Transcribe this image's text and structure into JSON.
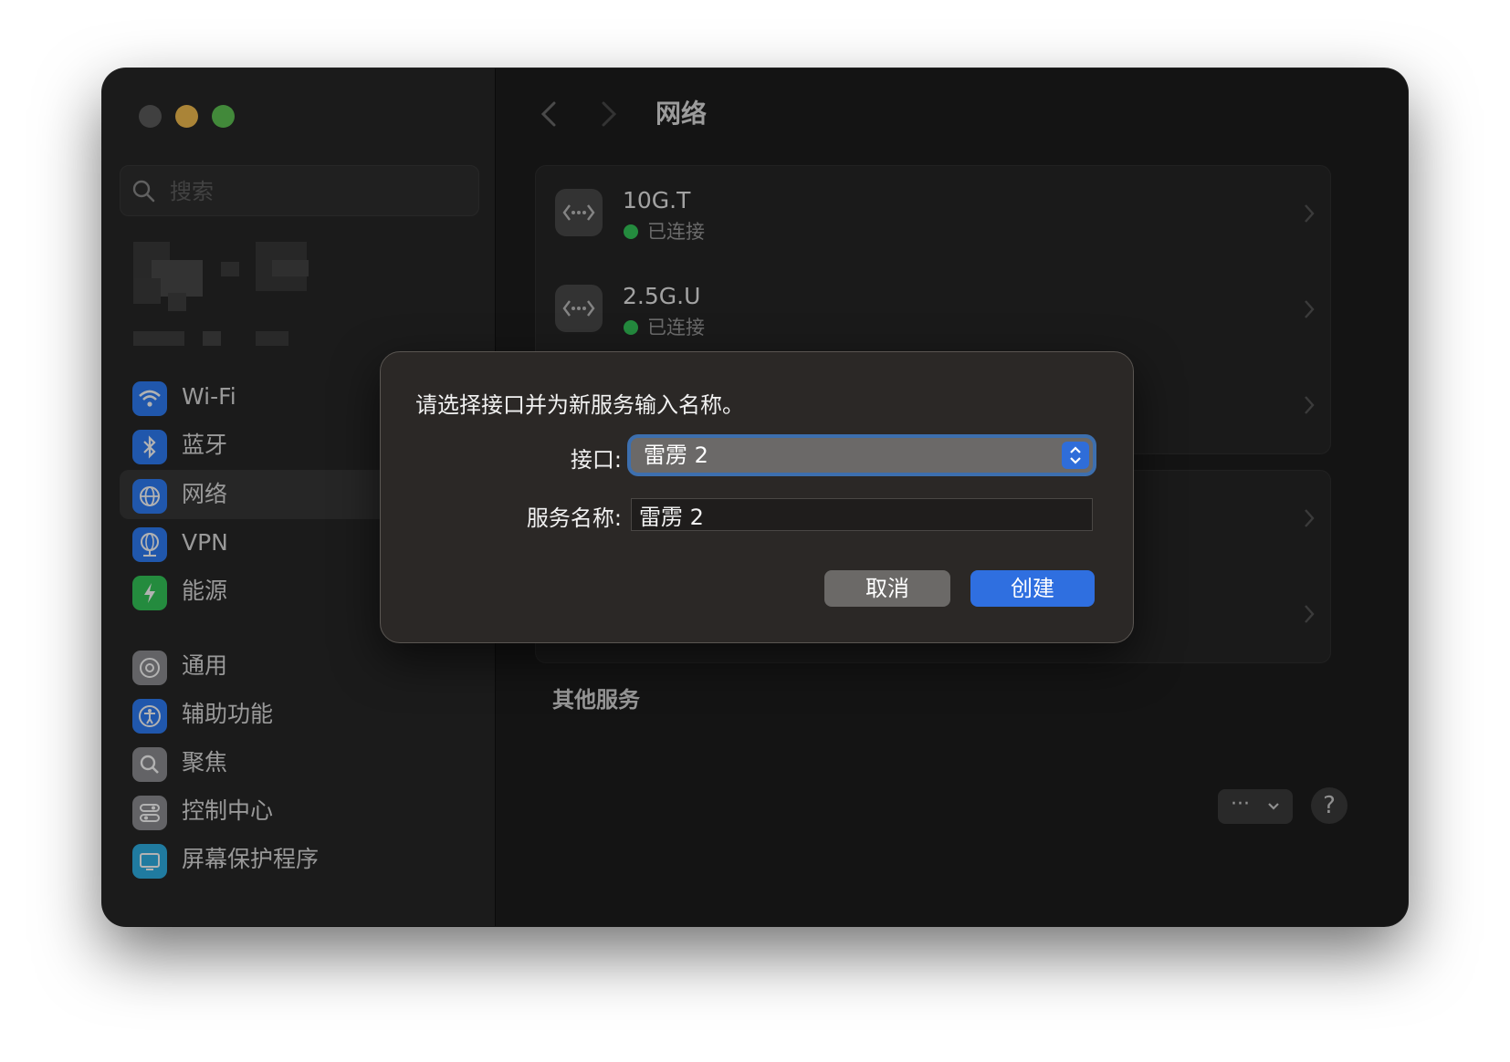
{
  "sidebar": {
    "search_placeholder": "搜索",
    "items": [
      {
        "label": "Wi-Fi",
        "icon": "wifi-icon",
        "color": "#2f7df6"
      },
      {
        "label": "蓝牙",
        "icon": "bluetooth-icon",
        "color": "#2f7df6"
      },
      {
        "label": "网络",
        "icon": "globe-icon",
        "color": "#2f7df6"
      },
      {
        "label": "VPN",
        "icon": "vpn-globe-icon",
        "color": "#2f7df6"
      },
      {
        "label": "能源",
        "icon": "battery-bolt-icon",
        "color": "#34c759"
      },
      {
        "label": "通用",
        "icon": "gear-icon",
        "color": "#8e8e93"
      },
      {
        "label": "辅助功能",
        "icon": "accessibility-icon",
        "color": "#2f7df6"
      },
      {
        "label": "聚焦",
        "icon": "magnifier-icon",
        "color": "#8e8e93"
      },
      {
        "label": "控制中心",
        "icon": "toggles-icon",
        "color": "#8e8e93"
      },
      {
        "label": "屏幕保护程序",
        "icon": "screen-saver-icon",
        "color": "#2fb1e6"
      }
    ]
  },
  "header": {
    "title": "网络"
  },
  "network": {
    "services": [
      {
        "name": "10G.T",
        "status": "已连接",
        "icon": "ethernet-icon"
      },
      {
        "name": "2.5G.U",
        "status": "已连接",
        "icon": "ethernet-icon"
      }
    ],
    "other_services_label": "其他服务",
    "more_button_label": "···",
    "help_label": "?"
  },
  "dialog": {
    "message": "请选择接口并为新服务输入名称。",
    "interface_label": "接口:",
    "interface_value": "雷雳 2",
    "service_name_label": "服务名称:",
    "service_name_value": "雷雳 2",
    "cancel_label": "取消",
    "create_label": "创建",
    "accent_color": "#2f6fe0"
  }
}
